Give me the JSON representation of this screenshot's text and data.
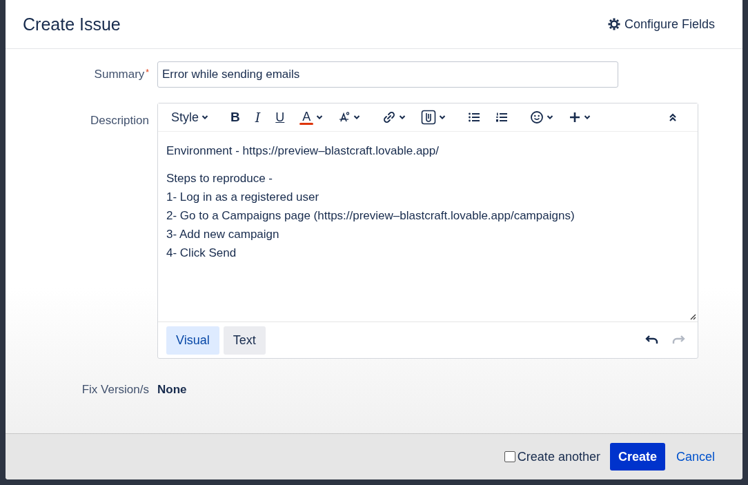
{
  "dialog": {
    "title": "Create Issue",
    "configure_link": "Configure Fields"
  },
  "summary": {
    "label": "Summary",
    "required_mark": "*",
    "value": "Error while sending emails"
  },
  "description": {
    "label": "Description",
    "toolbar": [
      {
        "kind": "style",
        "label": "Style"
      },
      {
        "kind": "bold",
        "label": "B"
      },
      {
        "kind": "italic",
        "label": "I"
      },
      {
        "kind": "underline",
        "label": "U"
      },
      {
        "kind": "color",
        "label": "A"
      },
      {
        "kind": "clear"
      },
      {
        "kind": "link"
      },
      {
        "kind": "attach"
      },
      {
        "kind": "bullets"
      },
      {
        "kind": "numbers"
      },
      {
        "kind": "emoji"
      },
      {
        "kind": "insert"
      },
      {
        "kind": "collapse"
      }
    ],
    "paragraphs": [
      [
        "Environment - https://preview–blastcraft.lovable.app/"
      ],
      [
        "Steps to reproduce -",
        "1- Log in as a registered user",
        "2- Go to a Campaigns page (https://preview–blastcraft.lovable.app/campaigns)",
        "3- Add new campaign",
        "4- Click Send"
      ]
    ],
    "modes": [
      {
        "label": "Visual",
        "selected": true
      },
      {
        "label": "Text",
        "selected": false
      }
    ],
    "history": [
      {
        "kind": "undo",
        "disabled": false
      },
      {
        "kind": "redo",
        "disabled": true
      }
    ]
  },
  "fix_version": {
    "label": "Fix Version/s",
    "value": "None"
  },
  "footer": {
    "create_another": {
      "label": "Create another",
      "checked": false
    },
    "create_button": "Create",
    "cancel_link": "Cancel"
  }
}
